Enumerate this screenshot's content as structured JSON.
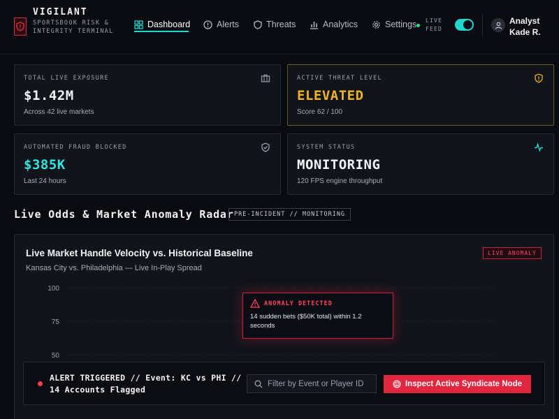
{
  "brand": {
    "title": "VIGILANT",
    "subtitle": "SPORTSBOOK RISK & INTEGRITY TERMINAL"
  },
  "nav": {
    "items": [
      {
        "label": "Dashboard",
        "icon": "dashboard-icon",
        "active": true
      },
      {
        "label": "Alerts",
        "icon": "alert-circle-icon",
        "active": false
      },
      {
        "label": "Threats",
        "icon": "shield-icon",
        "active": false
      },
      {
        "label": "Analytics",
        "icon": "bar-chart-icon",
        "active": false
      },
      {
        "label": "Settings",
        "icon": "gear-icon",
        "active": false
      }
    ]
  },
  "live_feed": {
    "label": "LIVE FEED",
    "enabled": true
  },
  "user": {
    "line1": "Analyst",
    "line2": "Kade R."
  },
  "cards": [
    {
      "label": "TOTAL LIVE EXPOSURE",
      "value": "$1.42M",
      "sub": "Across 42 live markets",
      "icon": "briefcase-icon",
      "value_color": "#f2f3f6"
    },
    {
      "label": "ACTIVE THREAT LEVEL",
      "value": "ELEVATED",
      "sub": "Score 62 / 100",
      "icon": "shield-alert-icon",
      "value_color": "#f0b323"
    },
    {
      "label": "AUTOMATED FRAUD BLOCKED",
      "value": "$385K",
      "sub": "Last 24 hours",
      "icon": "shield-check-icon",
      "value_color": "#2ee6e0"
    },
    {
      "label": "SYSTEM STATUS",
      "value": "MONITORING",
      "sub": "120 FPS engine throughput",
      "icon": "activity-icon",
      "value_color": "#f2f3f6"
    }
  ],
  "section": {
    "title": "Live Odds & Market Anomaly Radar",
    "tag": "PRE-INCIDENT // MONITORING"
  },
  "chart": {
    "title": "Live Market Handle Velocity vs. Historical Baseline",
    "subtitle": "Kansas City vs. Philadelphia — Live In-Play Spread",
    "badge": "LIVE ANOMALY"
  },
  "chart_data": {
    "type": "line",
    "title": "Live Market Handle Velocity vs. Historical Baseline",
    "subtitle": "Kansas City vs. Philadelphia — Live In-Play Spread",
    "y_ticks": [
      100,
      75,
      50
    ],
    "grid": true
  },
  "anomaly": {
    "heading": "ANOMALY DETECTED",
    "text": "14 sudden bets ($50K total) within 1.2 seconds"
  },
  "alert": {
    "text": "ALERT TRIGGERED // Event: KC vs PHI // 14 Accounts Flagged",
    "search_placeholder": "Filter by Event or Player ID",
    "button_label": "Inspect Active Syndicate Node"
  },
  "colors": {
    "accent": "#1fd8d0",
    "danger": "#e3263f",
    "warning": "#f0b323"
  }
}
